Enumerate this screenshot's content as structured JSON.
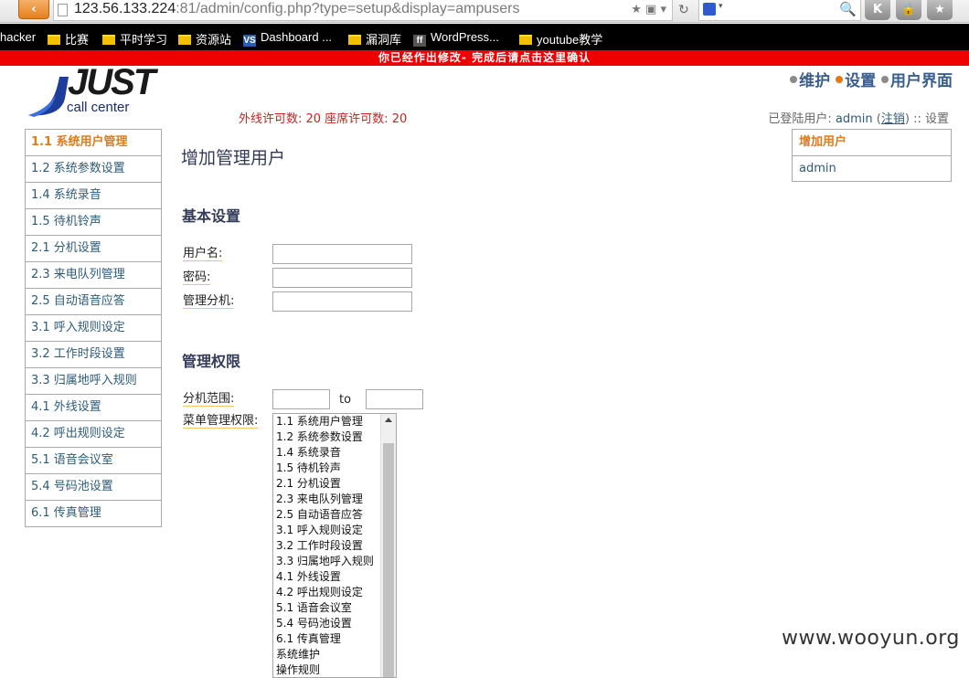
{
  "browser": {
    "back_label": "‹",
    "url_host": "123.56.133.224",
    "url_rest": ":81/admin/config.php?type=setup&display=ampusers",
    "url_icons": "★ ▣ ▾",
    "reload_icon": "↻",
    "search_go_icon": "🔍",
    "extensions": [
      "K",
      "🔒",
      "★"
    ],
    "bookmarks": [
      {
        "label": "hacker",
        "icon": "none"
      },
      {
        "label": "比赛",
        "icon": "folder-icon"
      },
      {
        "label": "平时学习",
        "icon": "folder-icon"
      },
      {
        "label": "资源站",
        "icon": "folder-icon"
      },
      {
        "label": "Dashboard ...",
        "icon": "vs-icon"
      },
      {
        "label": "漏洞库",
        "icon": "folder-icon"
      },
      {
        "label": "WordPress...",
        "icon": "ff-icon"
      },
      {
        "label": "youtube教学",
        "icon": "folder-icon"
      }
    ]
  },
  "notice": "你已经作出修改- 完成后请点击这里确认",
  "header": {
    "logo_word": "JUST",
    "logo_sub": "call center",
    "license": "外线许可数: 20 座席许可数: 20",
    "nav": [
      "维护",
      "设置",
      "用户界面"
    ],
    "login_prefix": "已登陆用户: ",
    "login_user": "admin",
    "logout": "注销",
    "login_suffix": " :: 设置"
  },
  "sidebar": [
    "1.1 系统用户管理",
    "1.2 系统参数设置",
    "1.4 系统录音",
    "1.5 待机铃声",
    "2.1 分机设置",
    "2.3 来电队列管理",
    "2.5 自动语音应答",
    "3.1 呼入规则设定",
    "3.2 工作时段设置",
    "3.3 归属地呼入规则",
    "4.1 外线设置",
    "4.2 呼出规则设定",
    "5.1 语音会议室",
    "5.4 号码池设置",
    "6.1 传真管理"
  ],
  "rightpanel": {
    "head": "增加用户",
    "items": [
      "admin"
    ]
  },
  "main": {
    "title": "增加管理用户",
    "basic_section": "基本设置",
    "username_label": "用户名:",
    "password_label": "密码:",
    "extension_label": "管理分机:",
    "perm_section": "管理权限",
    "range_label": "分机范围:",
    "range_to": "to",
    "menu_perm_label": "菜单管理权限:",
    "menu_options": [
      "1.1 系统用户管理",
      "1.2 系统参数设置",
      "1.4 系统录音",
      "1.5 待机铃声",
      "2.1 分机设置",
      "2.3 来电队列管理",
      "2.5 自动语音应答",
      "3.1 呼入规则设定",
      "3.2 工作时段设置",
      "3.3 归属地呼入规则",
      "4.1 外线设置",
      "4.2 呼出规则设定",
      "5.1 语音会议室",
      "5.4 号码池设置",
      "6.1 传真管理",
      "系统维护",
      "操作规则"
    ]
  },
  "watermark": "www.wooyun.org"
}
